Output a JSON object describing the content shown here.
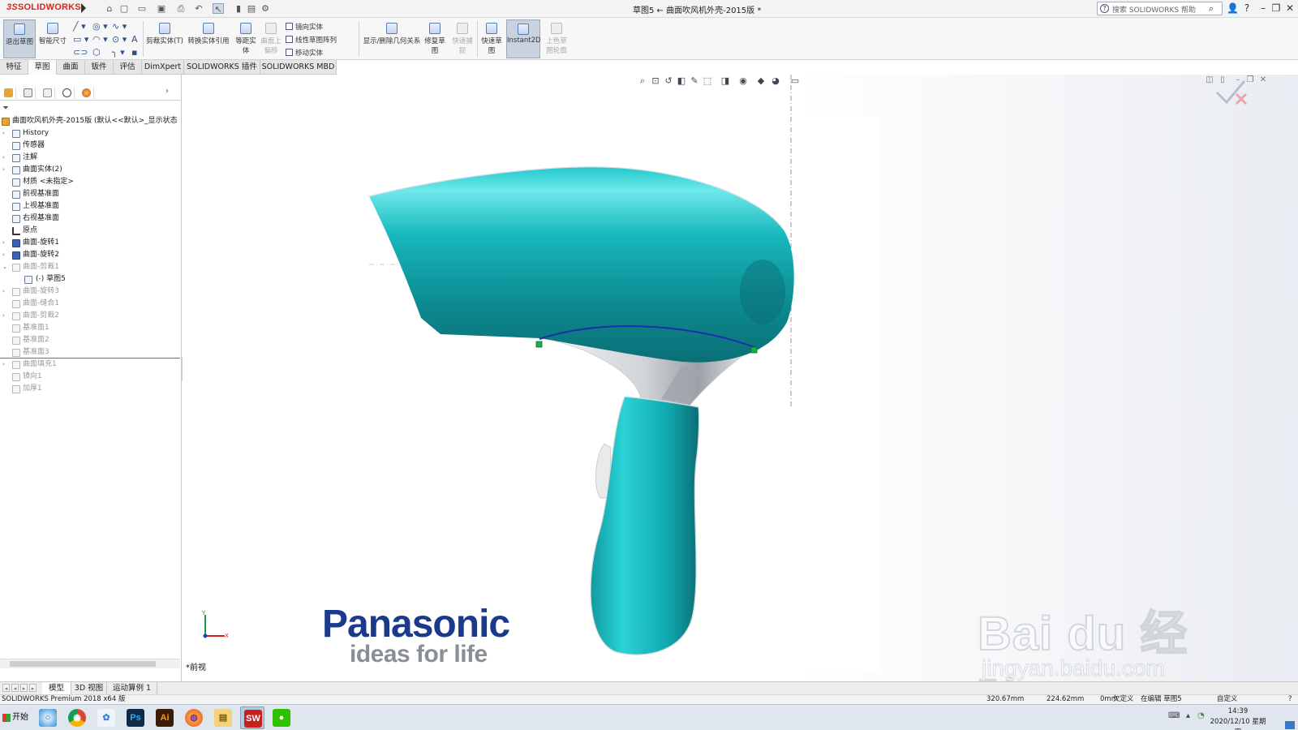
{
  "app": {
    "brand": "SOLIDWORKS",
    "document_title": "草图5 ← 曲面吹风机外壳-2015版 *",
    "search_placeholder": "搜索 SOLIDWORKS 帮助"
  },
  "ribbon": {
    "buttons": [
      {
        "label": "退出草图",
        "icon": "exit-sketch-icon",
        "active": true
      },
      {
        "label": "智能尺寸",
        "icon": "smart-dimension-icon"
      },
      {
        "label": "剪裁实体(T)",
        "icon": "trim-entities-icon"
      },
      {
        "label": "转换实体引用",
        "icon": "convert-entities-icon"
      },
      {
        "label": "等距实体",
        "icon": "offset-entities-icon"
      },
      {
        "label": "曲面上偏移",
        "icon": "offset-on-surface-icon",
        "disabled": true
      },
      {
        "label": "显示/删除几何关系",
        "icon": "display-relations-icon"
      },
      {
        "label": "修复草图",
        "icon": "repair-sketch-icon"
      },
      {
        "label": "快速捕捉",
        "icon": "quick-snaps-icon",
        "disabled": true
      },
      {
        "label": "快速草图",
        "icon": "rapid-sketch-icon"
      },
      {
        "label": "Instant2D",
        "icon": "instant2d-icon",
        "active": true
      },
      {
        "label": "上色草图轮廓",
        "icon": "shaded-sketch-icon",
        "disabled": true
      }
    ],
    "small_items": [
      "镜向实体",
      "线性草图阵列",
      "移动实体"
    ]
  },
  "command_tabs": [
    "特征",
    "草图",
    "曲面",
    "钣件",
    "评估",
    "DimXpert",
    "SOLIDWORKS 插件",
    "SOLIDWORKS MBD"
  ],
  "active_command_tab": "草图",
  "feature_tree": {
    "root": "曲面吹风机外壳-2015版  (默认<<默认>_显示状态",
    "items": [
      {
        "label": "History",
        "expander": true
      },
      {
        "label": "传感器"
      },
      {
        "label": "注解",
        "expander": true
      },
      {
        "label": "曲面实体(2)",
        "expander": true
      },
      {
        "label": "材质 <未指定>"
      },
      {
        "label": "前视基准面"
      },
      {
        "label": "上视基准面"
      },
      {
        "label": "右视基准面"
      },
      {
        "label": "原点"
      },
      {
        "label": "曲面-旋转1",
        "expander": true
      },
      {
        "label": "曲面-旋转2",
        "expander": true
      },
      {
        "label": "曲面-剪裁1",
        "expander": true,
        "dim": true
      },
      {
        "label": "(-) 草图5",
        "child": true
      },
      {
        "label": "曲面-旋转3",
        "expander": true,
        "dim": true
      },
      {
        "label": "曲面-缝合1",
        "dim": true
      },
      {
        "label": "曲面-剪裁2",
        "expander": true,
        "dim": true
      },
      {
        "label": "基准面1",
        "dim": true
      },
      {
        "label": "基准面2",
        "dim": true
      },
      {
        "label": "基准面3",
        "dim": true
      },
      {
        "label": "曲面填充1",
        "expander": true,
        "dim": true
      },
      {
        "label": "镜向1",
        "dim": true
      },
      {
        "label": "加厚1",
        "dim": true
      }
    ]
  },
  "viewport": {
    "view_name": "*前视",
    "triad_y": "Y",
    "triad_x": "X",
    "image_brand": "Panasonic",
    "image_tagline": "ideas for life",
    "watermark_logo": "Bai du 经验",
    "watermark_url": "jingyan.baidu.com"
  },
  "model_tabs": [
    "模型",
    "3D 视图",
    "运动算例 1"
  ],
  "status_bar": {
    "product": "SOLIDWORKS Premium 2018 x64 版",
    "x": "320.67mm",
    "y": "224.62mm",
    "z": "0mm",
    "definition": "欠定义",
    "mode": "在编辑 草图5",
    "units": "自定义"
  },
  "taskbar": {
    "start_label": "开始",
    "apps": [
      {
        "name": "browser-app",
        "glyph": "○"
      },
      {
        "name": "chrome-app",
        "glyph": "◉"
      },
      {
        "name": "network-app",
        "glyph": "✿"
      },
      {
        "name": "photoshop-app",
        "glyph": "Ps"
      },
      {
        "name": "illustrator-app",
        "glyph": "Ai"
      },
      {
        "name": "firefox-app",
        "glyph": "◍"
      },
      {
        "name": "explorer-app",
        "glyph": "▤"
      },
      {
        "name": "solidworks-app",
        "glyph": "SW"
      },
      {
        "name": "wechat-app",
        "glyph": "●"
      }
    ],
    "time": "14:39",
    "date": "2020/12/10 星期四"
  },
  "colors": {
    "brand_red": "#d7261e",
    "dryer_teal": "#13b4b8",
    "dryer_dark": "#0a6f75",
    "sketch_blue": "#1830b0",
    "endpoint_green": "#18b04a",
    "panasonic_blue": "#1b3a8c"
  }
}
